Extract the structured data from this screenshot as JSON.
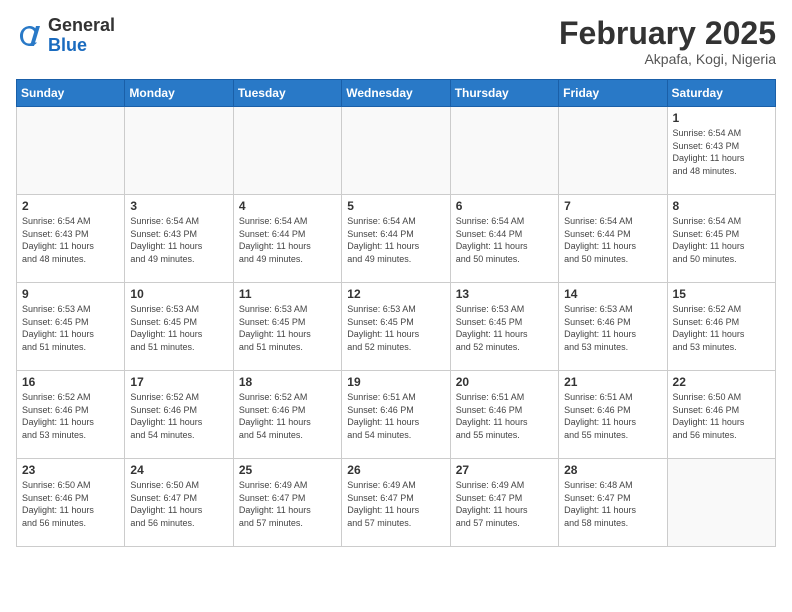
{
  "header": {
    "logo_general": "General",
    "logo_blue": "Blue",
    "title": "February 2025",
    "subtitle": "Akpafa, Kogi, Nigeria"
  },
  "weekdays": [
    "Sunday",
    "Monday",
    "Tuesday",
    "Wednesday",
    "Thursday",
    "Friday",
    "Saturday"
  ],
  "weeks": [
    [
      {
        "day": "",
        "detail": ""
      },
      {
        "day": "",
        "detail": ""
      },
      {
        "day": "",
        "detail": ""
      },
      {
        "day": "",
        "detail": ""
      },
      {
        "day": "",
        "detail": ""
      },
      {
        "day": "",
        "detail": ""
      },
      {
        "day": "1",
        "detail": "Sunrise: 6:54 AM\nSunset: 6:43 PM\nDaylight: 11 hours\nand 48 minutes."
      }
    ],
    [
      {
        "day": "2",
        "detail": "Sunrise: 6:54 AM\nSunset: 6:43 PM\nDaylight: 11 hours\nand 48 minutes."
      },
      {
        "day": "3",
        "detail": "Sunrise: 6:54 AM\nSunset: 6:43 PM\nDaylight: 11 hours\nand 49 minutes."
      },
      {
        "day": "4",
        "detail": "Sunrise: 6:54 AM\nSunset: 6:44 PM\nDaylight: 11 hours\nand 49 minutes."
      },
      {
        "day": "5",
        "detail": "Sunrise: 6:54 AM\nSunset: 6:44 PM\nDaylight: 11 hours\nand 49 minutes."
      },
      {
        "day": "6",
        "detail": "Sunrise: 6:54 AM\nSunset: 6:44 PM\nDaylight: 11 hours\nand 50 minutes."
      },
      {
        "day": "7",
        "detail": "Sunrise: 6:54 AM\nSunset: 6:44 PM\nDaylight: 11 hours\nand 50 minutes."
      },
      {
        "day": "8",
        "detail": "Sunrise: 6:54 AM\nSunset: 6:45 PM\nDaylight: 11 hours\nand 50 minutes."
      }
    ],
    [
      {
        "day": "9",
        "detail": "Sunrise: 6:53 AM\nSunset: 6:45 PM\nDaylight: 11 hours\nand 51 minutes."
      },
      {
        "day": "10",
        "detail": "Sunrise: 6:53 AM\nSunset: 6:45 PM\nDaylight: 11 hours\nand 51 minutes."
      },
      {
        "day": "11",
        "detail": "Sunrise: 6:53 AM\nSunset: 6:45 PM\nDaylight: 11 hours\nand 51 minutes."
      },
      {
        "day": "12",
        "detail": "Sunrise: 6:53 AM\nSunset: 6:45 PM\nDaylight: 11 hours\nand 52 minutes."
      },
      {
        "day": "13",
        "detail": "Sunrise: 6:53 AM\nSunset: 6:45 PM\nDaylight: 11 hours\nand 52 minutes."
      },
      {
        "day": "14",
        "detail": "Sunrise: 6:53 AM\nSunset: 6:46 PM\nDaylight: 11 hours\nand 53 minutes."
      },
      {
        "day": "15",
        "detail": "Sunrise: 6:52 AM\nSunset: 6:46 PM\nDaylight: 11 hours\nand 53 minutes."
      }
    ],
    [
      {
        "day": "16",
        "detail": "Sunrise: 6:52 AM\nSunset: 6:46 PM\nDaylight: 11 hours\nand 53 minutes."
      },
      {
        "day": "17",
        "detail": "Sunrise: 6:52 AM\nSunset: 6:46 PM\nDaylight: 11 hours\nand 54 minutes."
      },
      {
        "day": "18",
        "detail": "Sunrise: 6:52 AM\nSunset: 6:46 PM\nDaylight: 11 hours\nand 54 minutes."
      },
      {
        "day": "19",
        "detail": "Sunrise: 6:51 AM\nSunset: 6:46 PM\nDaylight: 11 hours\nand 54 minutes."
      },
      {
        "day": "20",
        "detail": "Sunrise: 6:51 AM\nSunset: 6:46 PM\nDaylight: 11 hours\nand 55 minutes."
      },
      {
        "day": "21",
        "detail": "Sunrise: 6:51 AM\nSunset: 6:46 PM\nDaylight: 11 hours\nand 55 minutes."
      },
      {
        "day": "22",
        "detail": "Sunrise: 6:50 AM\nSunset: 6:46 PM\nDaylight: 11 hours\nand 56 minutes."
      }
    ],
    [
      {
        "day": "23",
        "detail": "Sunrise: 6:50 AM\nSunset: 6:46 PM\nDaylight: 11 hours\nand 56 minutes."
      },
      {
        "day": "24",
        "detail": "Sunrise: 6:50 AM\nSunset: 6:47 PM\nDaylight: 11 hours\nand 56 minutes."
      },
      {
        "day": "25",
        "detail": "Sunrise: 6:49 AM\nSunset: 6:47 PM\nDaylight: 11 hours\nand 57 minutes."
      },
      {
        "day": "26",
        "detail": "Sunrise: 6:49 AM\nSunset: 6:47 PM\nDaylight: 11 hours\nand 57 minutes."
      },
      {
        "day": "27",
        "detail": "Sunrise: 6:49 AM\nSunset: 6:47 PM\nDaylight: 11 hours\nand 57 minutes."
      },
      {
        "day": "28",
        "detail": "Sunrise: 6:48 AM\nSunset: 6:47 PM\nDaylight: 11 hours\nand 58 minutes."
      },
      {
        "day": "",
        "detail": ""
      }
    ]
  ]
}
